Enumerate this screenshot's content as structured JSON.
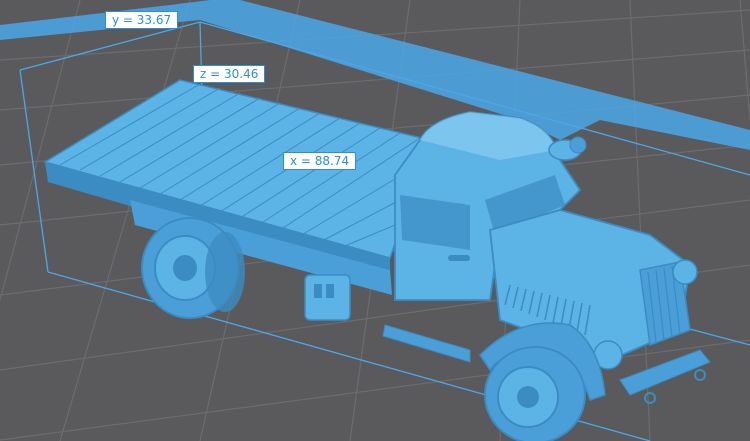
{
  "colors": {
    "background": "#5a5a5c",
    "grid": "#6c6c6e",
    "model": "#5cb3e6",
    "model_dark": "#3b8cc2",
    "model_light": "#8fd0f5",
    "bounding_box": "#4aa8e8",
    "label_border": "#2b8fd6"
  },
  "model": {
    "name_icon": "truck-3d-model"
  },
  "dimensions": {
    "y_label": "y = 33.67",
    "z_label": "z = 30.46",
    "x_label": "x = 88.74"
  }
}
